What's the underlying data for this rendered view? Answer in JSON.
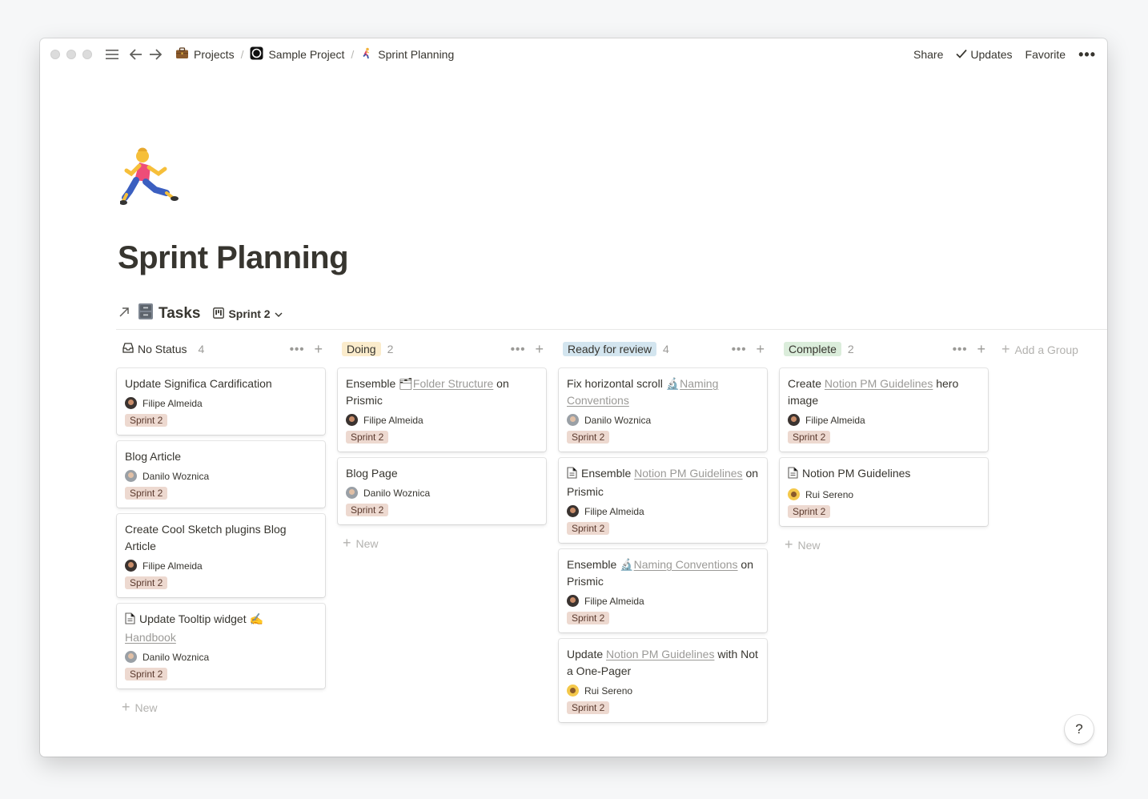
{
  "breadcrumbs": [
    {
      "icon": "briefcase-icon",
      "label": "Projects"
    },
    {
      "icon": "notion-logo-icon",
      "label": "Sample Project"
    },
    {
      "icon": "runner-icon",
      "label": "Sprint Planning"
    }
  ],
  "actions": {
    "share": "Share",
    "updates": "Updates",
    "favorite": "Favorite"
  },
  "page": {
    "icon": "runner-emoji",
    "title": "Sprint Planning"
  },
  "database": {
    "title": "Tasks",
    "view": "Sprint 2"
  },
  "add_group_label": "Add a Group",
  "new_label": "New",
  "help_label": "?",
  "colors": {
    "no_status": "#ffffff",
    "doing": "#fbeccc",
    "ready": "#d3e5ef",
    "complete": "#dbeddb",
    "tag": "#edd9d0"
  },
  "columns": [
    {
      "label": "No Status",
      "count": "4",
      "cards": [
        {
          "prefix": "Update Significa Cardification",
          "link": "",
          "suffix": "",
          "person": "Filipe Almeida",
          "tag": "Sprint 2"
        },
        {
          "prefix": "Blog Article",
          "link": "",
          "suffix": "",
          "person": "Danilo Woznica",
          "tag": "Sprint 2"
        },
        {
          "prefix": "Create Cool Sketch plugins Blog Article",
          "link": "",
          "suffix": "",
          "person": "Filipe Almeida",
          "tag": "Sprint 2"
        },
        {
          "prefix": "Update Tooltip widget ✍️",
          "link": "Handbook",
          "suffix": "",
          "person": "Danilo Woznica",
          "tag": "Sprint 2"
        }
      ]
    },
    {
      "label": "Doing",
      "count": "2",
      "cards": [
        {
          "prefix": "Ensemble 🗂",
          "link": "Folder Structure",
          "suffix": " on Prismic",
          "person": "Filipe Almeida",
          "tag": "Sprint 2"
        },
        {
          "prefix": "Blog Page",
          "link": "",
          "suffix": "",
          "person": "Danilo Woznica",
          "tag": "Sprint 2"
        }
      ]
    },
    {
      "label": "Ready for review",
      "count": "4",
      "cards": [
        {
          "prefix": "Fix horizontal scroll 🔬",
          "link": "Naming Conventions",
          "suffix": "",
          "person": "Danilo Woznica",
          "tag": "Sprint 2"
        },
        {
          "prefix": "Ensemble ",
          "link": "Notion PM Guidelines",
          "suffix": " on Prismic",
          "person": "Filipe Almeida",
          "tag": "Sprint 2"
        },
        {
          "prefix": "Ensemble 🔬",
          "link": "Naming Conventions",
          "suffix": " on Prismic",
          "person": "Filipe Almeida",
          "tag": "Sprint 2"
        },
        {
          "prefix": "Update ",
          "link": "Notion PM Guidelines",
          "suffix": " with Not a One-Pager",
          "person": "Rui Sereno",
          "tag": "Sprint 2"
        }
      ]
    },
    {
      "label": "Complete",
      "count": "2",
      "cards": [
        {
          "prefix": "Create ",
          "link": "Notion PM Guidelines",
          "suffix": " hero image",
          "person": "Filipe Almeida",
          "tag": "Sprint 2"
        },
        {
          "prefix": "Notion PM Guidelines",
          "link": "",
          "suffix": "",
          "person": "Rui Sereno",
          "tag": "Sprint 2"
        }
      ]
    }
  ]
}
